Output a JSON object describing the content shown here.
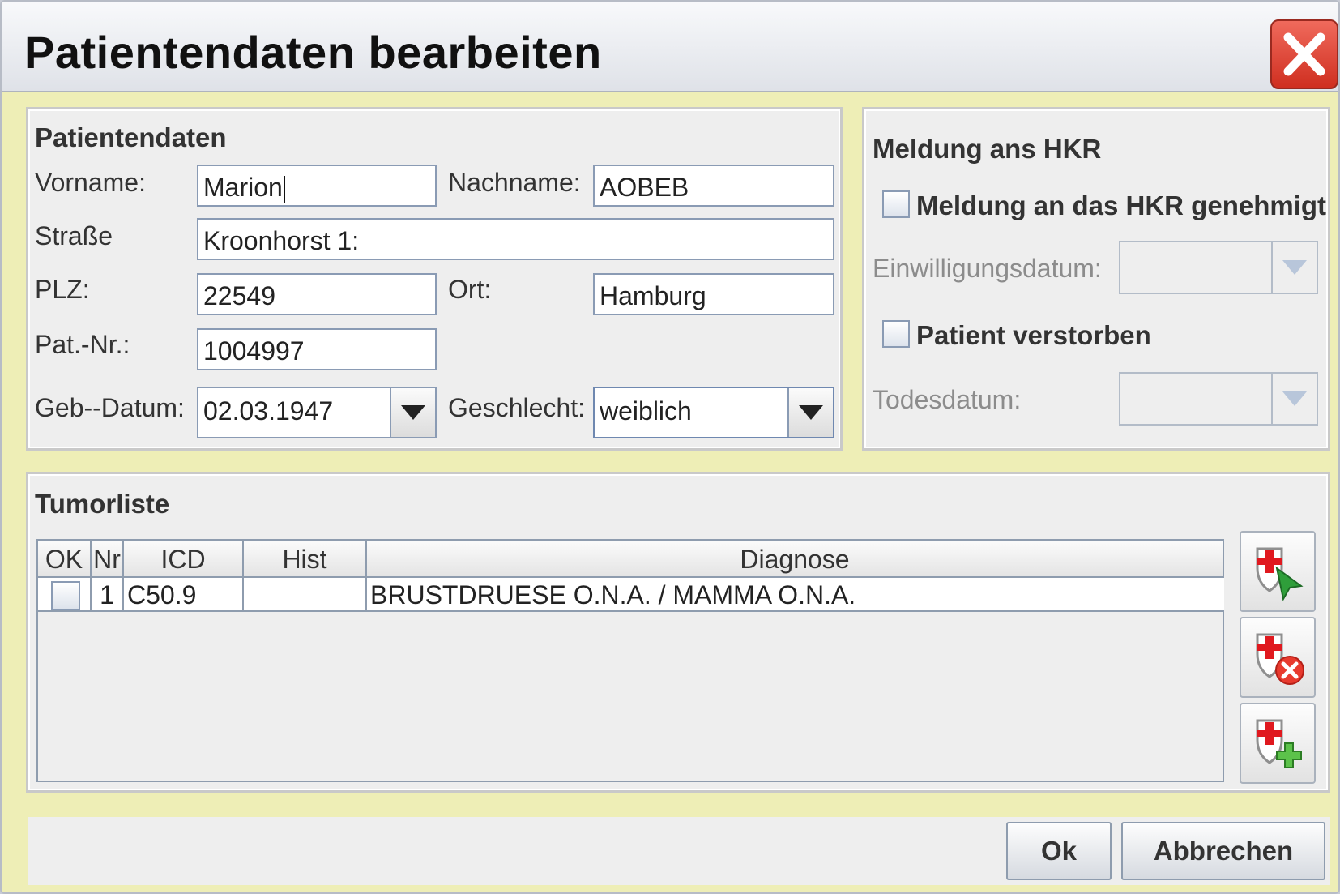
{
  "window": {
    "title": "Patientendaten bearbeiten",
    "close_icon": "close-icon"
  },
  "patient_panel": {
    "title": "Patientendaten",
    "vorname_label": "Vorname:",
    "vorname_value": "Marion",
    "nachname_label": "Nachname:",
    "nachname_value": "AOBEB",
    "strasse_label": "Straße",
    "strasse_value": "Kroonhorst 1:",
    "plz_label": "PLZ:",
    "plz_value": "22549",
    "ort_label": "Ort:",
    "ort_value": "Hamburg",
    "patnr_label": "Pat.-Nr.:",
    "patnr_value": "1004997",
    "gebdatum_label": "Geb--Datum:",
    "gebdatum_value": "02.03.1947",
    "geschlecht_label": "Geschlecht:",
    "geschlecht_value": "weiblich"
  },
  "hkr_panel": {
    "title": "Meldung ans HKR",
    "meldung_checkbox_label": "Meldung an das HKR genehmigt",
    "meldung_checked": false,
    "einwilligung_label": "Einwilligungsdatum:",
    "verstorben_checkbox_label": "Patient verstorben",
    "verstorben_checked": false,
    "todesdatum_label": "Todesdatum:"
  },
  "tumor_panel": {
    "title": "Tumorliste",
    "columns": [
      "OK",
      "Nr",
      "ICD",
      "Hist",
      "Diagnose"
    ],
    "rows": [
      {
        "ok": false,
        "nr": "1",
        "icd": "C50.9",
        "hist": "",
        "diagnose": "BRUSTDRUESE O.N.A. / MAMMA O.N.A."
      }
    ],
    "side_buttons": [
      "select-tumor-icon",
      "delete-tumor-icon",
      "add-tumor-icon"
    ]
  },
  "buttons": {
    "ok": "Ok",
    "cancel": "Abbrechen"
  },
  "colors": {
    "window_bg": "#eeeeb6",
    "panel_bg": "#eeeeee",
    "close_red": "#d93a2b",
    "field_border": "#8a9bb4"
  }
}
